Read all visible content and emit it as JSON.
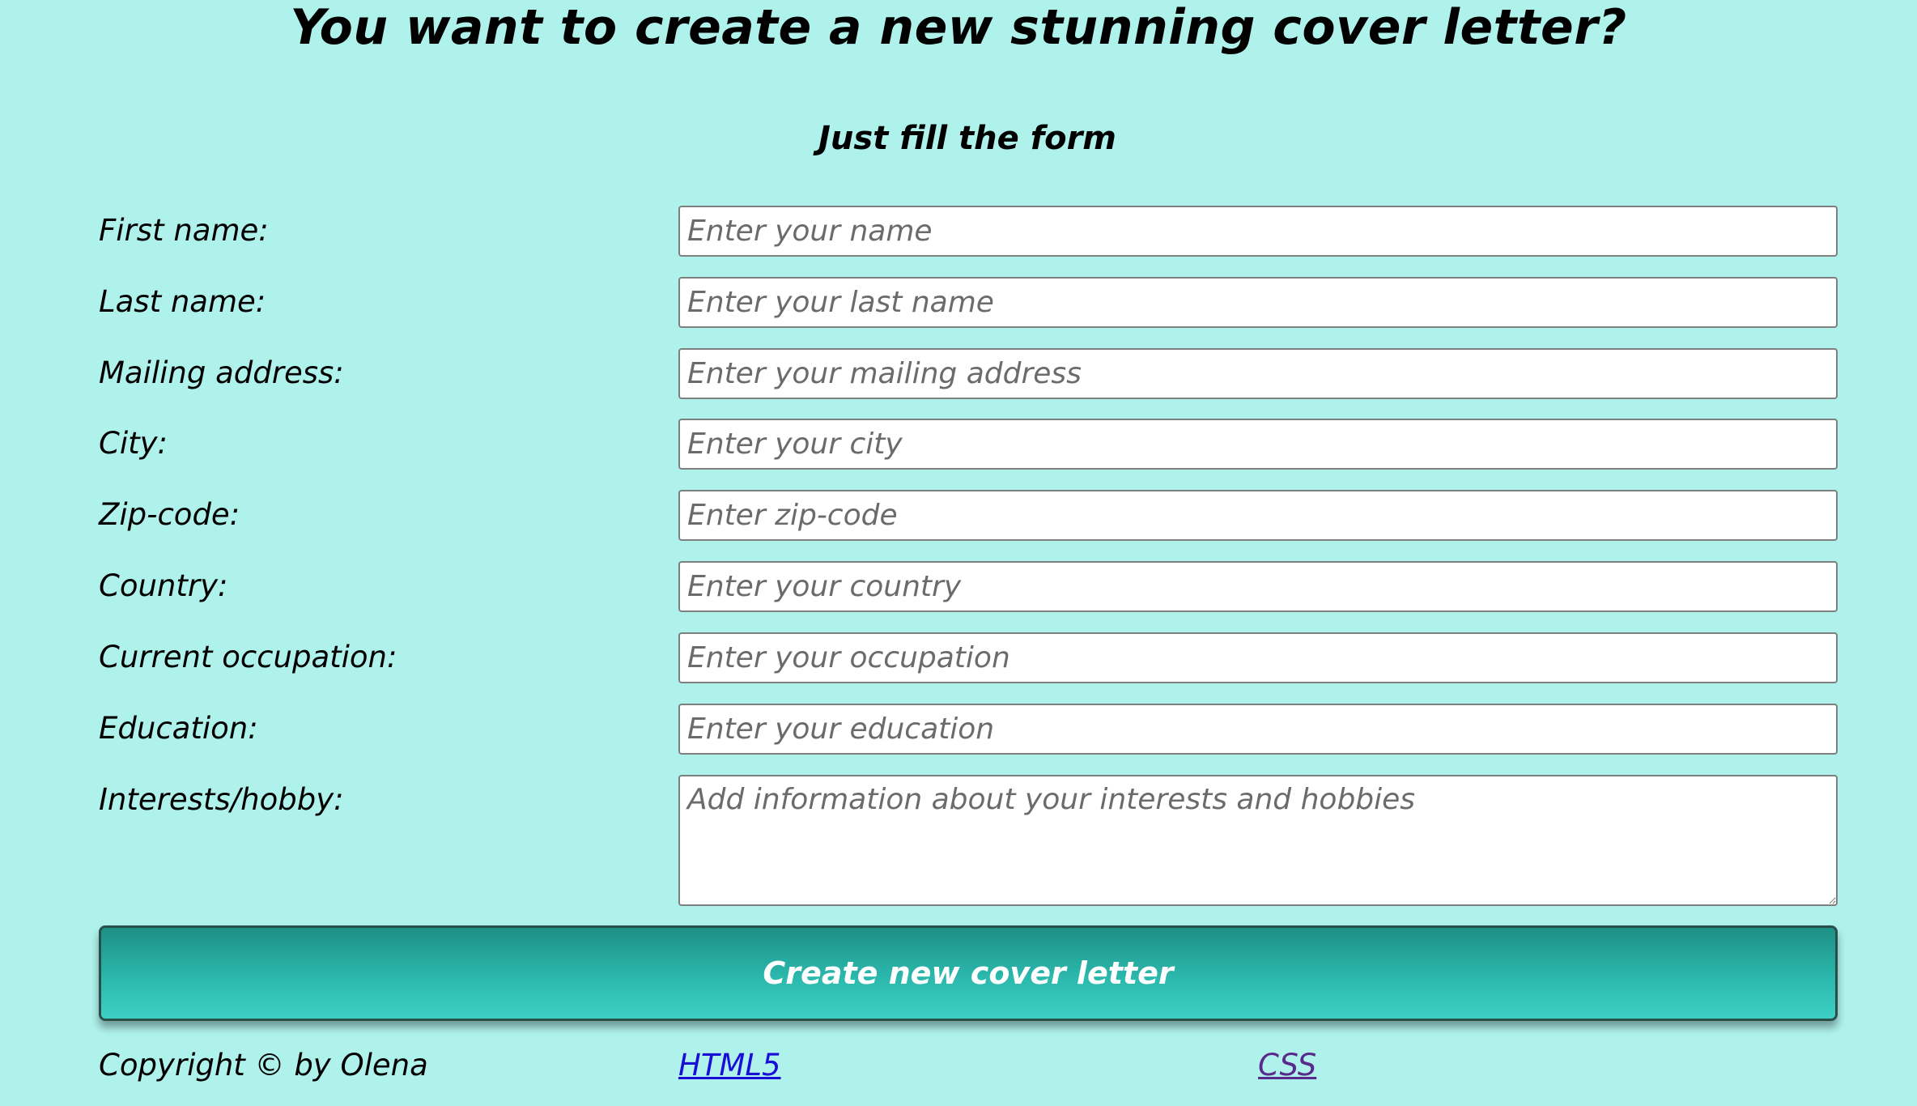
{
  "header": {
    "title": "You want to create a new stunning cover letter?",
    "subtitle": "Just fill the form"
  },
  "form": {
    "fields": [
      {
        "label": "First name:",
        "placeholder": "Enter your name",
        "value": ""
      },
      {
        "label": "Last name:",
        "placeholder": "Enter your last name",
        "value": ""
      },
      {
        "label": "Mailing address:",
        "placeholder": "Enter your mailing address",
        "value": ""
      },
      {
        "label": "City:",
        "placeholder": "Enter your city",
        "value": ""
      },
      {
        "label": "Zip-code:",
        "placeholder": "Enter zip-code",
        "value": ""
      },
      {
        "label": "Country:",
        "placeholder": "Enter your country",
        "value": ""
      },
      {
        "label": "Current occupation:",
        "placeholder": "Enter your occupation",
        "value": ""
      },
      {
        "label": "Education:",
        "placeholder": "Enter your education",
        "value": ""
      },
      {
        "label": "Interests/hobby:",
        "placeholder": "Add information about your interests and hobbies",
        "value": ""
      }
    ],
    "submit_label": "Create new cover letter"
  },
  "footer": {
    "copyright": "Copyright © by Olena",
    "link_html": "HTML5",
    "link_css": "CSS"
  },
  "colors": {
    "background": "#aff1eb",
    "button_top": "#1e8f86",
    "button_bottom": "#3dd0c4",
    "link_html": "#1a0dd6",
    "link_css": "#5a2a8a"
  }
}
